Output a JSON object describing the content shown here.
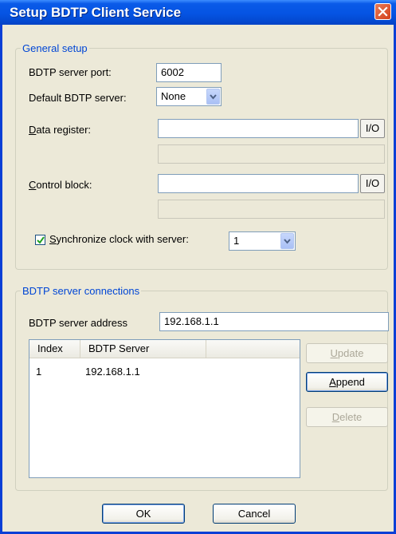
{
  "window": {
    "title": "Setup BDTP Client Service"
  },
  "general_setup": {
    "legend": "General setup",
    "server_port_label": "BDTP server port:",
    "server_port_value": "6002",
    "default_server_label": "Default BDTP server:",
    "default_server_value": "None",
    "data_register_label_u": "D",
    "data_register_label_rest": "ata register:",
    "data_register_value": "",
    "control_block_label_u": "C",
    "control_block_label_rest": "ontrol block:",
    "control_block_value": "",
    "io_button_label": "I/O",
    "sync_checked": true,
    "sync_label_u": "S",
    "sync_label_rest": "ynchronize clock with server:",
    "sync_value": "1"
  },
  "connections": {
    "legend": "BDTP server connections",
    "address_label": "BDTP server address",
    "address_value": "192.168.1.1",
    "columns": [
      "Index",
      "BDTP Server"
    ],
    "rows": [
      {
        "index": "1",
        "server": "192.168.1.1"
      }
    ],
    "update_u": "U",
    "update_rest": "pdate",
    "append_u": "A",
    "append_rest": "ppend",
    "delete_u": "D",
    "delete_rest": "elete"
  },
  "footer": {
    "ok_label": "OK",
    "cancel_label": "Cancel"
  },
  "colors": {
    "title_bar": "#0554e3",
    "group_legend": "#0046d5",
    "dialog_bg": "#ece9d8"
  },
  "icons": {
    "close": "close-icon",
    "dropdown": "chevron-down-icon",
    "check": "checkmark-icon"
  }
}
